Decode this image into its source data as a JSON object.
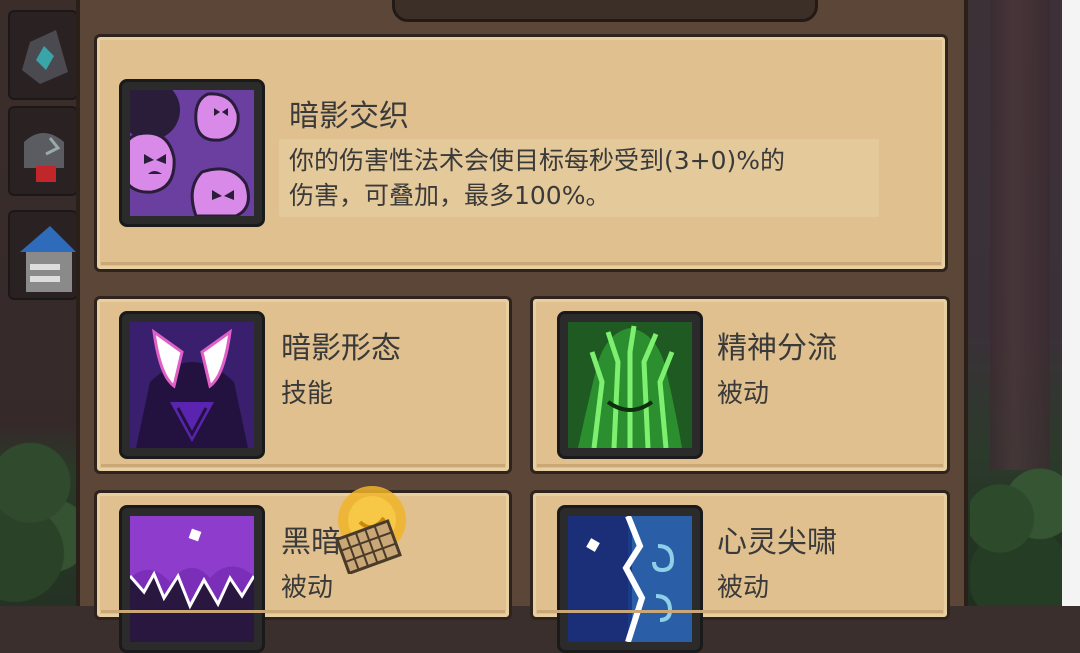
{
  "featured": {
    "title": "暗影交织",
    "description_line1": "你的伤害性法术会使目标每秒受到(3+0)%的",
    "description_line2": "伤害，可叠加，最多100%。",
    "icon": "purple-skulls-icon"
  },
  "skills": [
    {
      "name": "暗影形态",
      "type": "技能",
      "icon": "shadow-form-icon"
    },
    {
      "name": "精神分流",
      "type": "被动",
      "icon": "mind-split-icon"
    },
    {
      "name": "黑暗",
      "type": "被动",
      "icon": "darkness-icon"
    },
    {
      "name": "心灵尖啸",
      "type": "被动",
      "icon": "psychic-scream-icon"
    }
  ],
  "colors": {
    "card_bg": "#e0c08e",
    "panel_bg": "#5c4637",
    "text": "#3a3a3a"
  }
}
